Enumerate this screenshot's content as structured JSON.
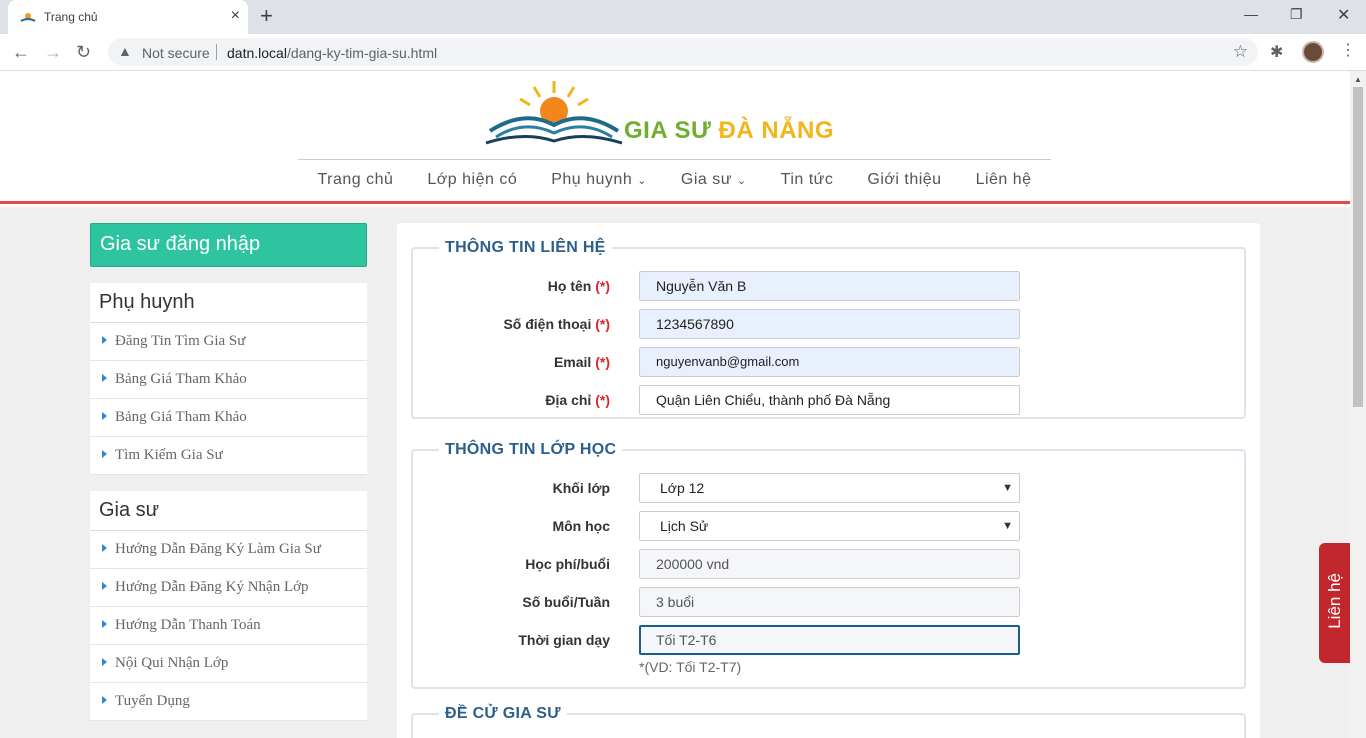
{
  "browser": {
    "tab_title": "Trang chủ",
    "not_secure": "Not secure",
    "url_host": "datn.local",
    "url_path": "/dang-ky-tim-gia-su.html"
  },
  "logo": {
    "text_a": "GIA SƯ ",
    "text_b": "ĐÀ NẴNG"
  },
  "nav": [
    "Trang chủ",
    "Lớp hiện có",
    "Phụ huynh",
    "Gia sư",
    "Tin tức",
    "Giới thiệu",
    "Liên hệ"
  ],
  "sidebar": {
    "login": "Gia sư đăng nhập",
    "groups": [
      {
        "title": "Phụ huynh",
        "items": [
          "Đăng Tin Tìm Gia Sư",
          "Bảng Giá Tham Khảo",
          "Bảng Giá Tham Khảo",
          "Tìm Kiếm Gia Sư"
        ]
      },
      {
        "title": "Gia sư",
        "items": [
          "Hướng Dẫn Đăng Ký Làm Gia Sư",
          "Hướng Dẫn Đăng Ký Nhận Lớp",
          "Hướng Dẫn Thanh Toán",
          "Nội Qui Nhận Lớp",
          "Tuyển Dụng"
        ]
      }
    ]
  },
  "contact": {
    "legend": "THÔNG TIN LIÊN HỆ",
    "required_mark": "(*)",
    "name_label": "Họ tên",
    "name_value": "Nguyễn Văn B",
    "phone_label": "Số điện thoại",
    "phone_value": "1234567890",
    "email_label": "Email",
    "email_value": "nguyenvanb@gmail.com",
    "address_label": "Địa chỉ",
    "address_value": "Quận Liên Chiểu, thành phố Đà Nẵng"
  },
  "class_info": {
    "legend": "THÔNG TIN LỚP HỌC",
    "grade_label": "Khối lớp",
    "grade_value": "Lớp 12",
    "subject_label": "Môn học",
    "subject_value": "Lịch Sử",
    "fee_label": "Học phí/buổi",
    "fee_value": "200000 vnd",
    "sessions_label": "Số buổi/Tuần",
    "sessions_value": "3 buổi",
    "time_label": "Thời gian dạy",
    "time_value": "Tối T2-T6",
    "time_hint": "*(VD: Tối T2-T7)"
  },
  "recommend": {
    "legend": "ĐỀ CỬ GIA SƯ"
  },
  "float_contact": "Liên hệ",
  "colors": {
    "accent": "#2ec4a0",
    "header_line": "#e34a4a",
    "legend": "#2b5f8a",
    "float": "#c1272d"
  }
}
